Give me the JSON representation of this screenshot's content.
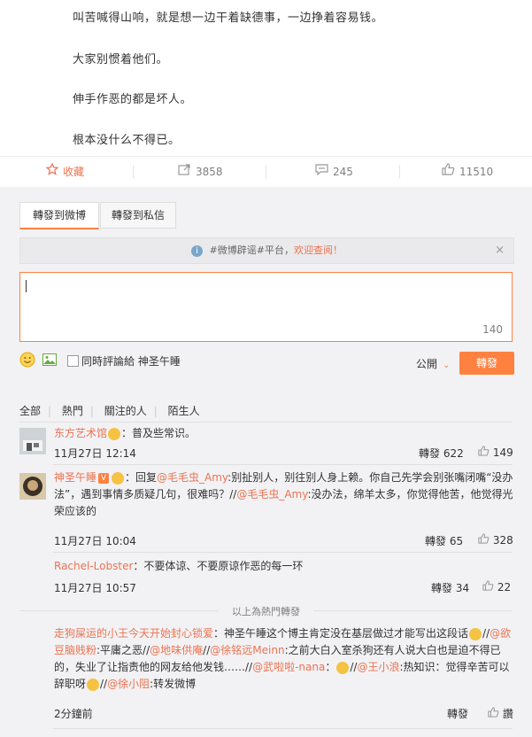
{
  "post": {
    "paragraphs": [
      "叫苦喊得山响，就是想一边干着缺德事，一边挣着容易钱。",
      "大家别惯着他们。",
      "伸手作恶的都是坏人。",
      "根本没什么不得已。"
    ]
  },
  "actions": {
    "favorite": "收藏",
    "repost_count": "3858",
    "comment_count": "245",
    "like_count": "11510"
  },
  "repost_panel": {
    "tab_weibo": "轉發到微博",
    "tab_private": "轉發到私信",
    "notice_prefix": "#微博辟谣#平台，",
    "notice_link": "欢迎查阅！",
    "char_count": "140",
    "also_comment_label": "同時評論給 神圣午睡",
    "visibility": "公開",
    "send_label": "轉發"
  },
  "filters": [
    "全部",
    "熱門",
    "關注的人",
    "陌生人"
  ],
  "comments": [
    {
      "user": "东方艺术馆",
      "text": "：普及些常识。",
      "time": "11月27日 12:14",
      "repost": "轉發 622",
      "likes": "149"
    },
    {
      "user": "神圣午睡",
      "text_a": "：回复",
      "mention1": "@毛毛虫_Amy",
      "text_b": ":别扯别人，别往别人身上赖。你自己先学会别张嘴闭嘴“没办法”，遇到事情多质疑几句，很难吗？//",
      "mention2": "@毛毛虫_Amy",
      "text_c": ":没办法，绵羊太多，你觉得他苦，他觉得光荣应该的",
      "time": "11月27日 10:04",
      "repost": "轉發 65",
      "likes": "328"
    },
    {
      "user": "Rachel-Lobster",
      "text": "：不要体谅、不要原谅作恶的每一环",
      "time": "11月27日 10:57",
      "repost": "轉發 34",
      "likes": "22"
    }
  ],
  "hot_divider": "以上為熱門轉發",
  "latest": {
    "user": "走狗屎运的小王今天开始封心锁爱",
    "t1": "：神圣午睡这个博主肯定没在基层做过才能写出这段话",
    "t2": "//",
    "m1": "@欲豆脑贱粉",
    "t3": ":平庸之恶//",
    "m2": "@地味供庵",
    "t4": "//",
    "m3": "@徐铭远Meinn",
    "t5": ":之前大白入室杀狗还有人说大白也是迫不得已的，失业了让指责他的网友给他发钱……//",
    "m4": "@武啦啦-nana",
    "t6": "：",
    "t7": "//",
    "m5": "@王小浪",
    "t8": ":热知识：觉得辛苦可以辞职呀",
    "t9": "//",
    "m6": "@徐小阻",
    "t10": ":转发微博",
    "time": "2分鐘前",
    "repost": "轉發",
    "like": "讚"
  }
}
